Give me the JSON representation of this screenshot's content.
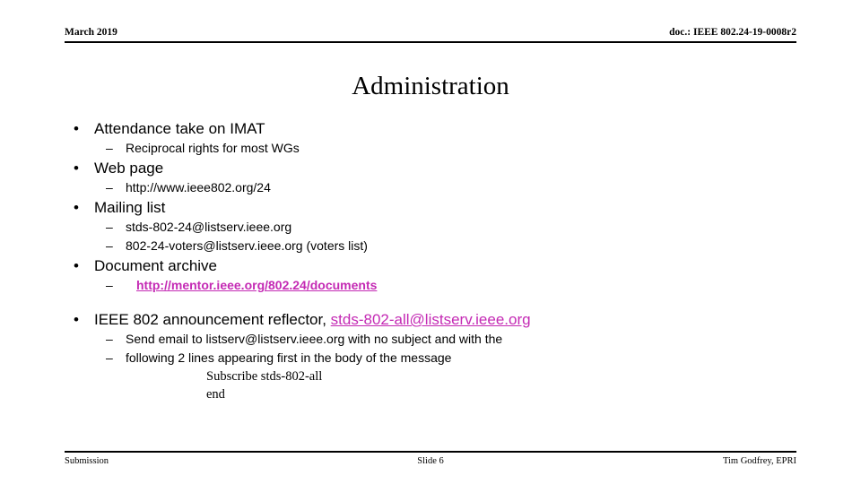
{
  "header": {
    "date": "March 2019",
    "doc_id": "doc.: IEEE 802.24-19-0008r2"
  },
  "title": "Administration",
  "colors": {
    "link": "#c42ab4",
    "text": "#000000",
    "background": "#ffffff"
  },
  "body": {
    "items": [
      {
        "level": 1,
        "text": "Attendance take on IMAT",
        "marker": "•"
      },
      {
        "level": 2,
        "text": "Reciprocal rights for most WGs",
        "marker": "–"
      },
      {
        "level": 1,
        "text": "Web page",
        "marker": "•"
      },
      {
        "level": 2,
        "text": "http://www.ieee802.org/24",
        "marker": "–"
      },
      {
        "level": 1,
        "text": "Mailing list",
        "marker": "•"
      },
      {
        "level": 2,
        "text": "stds-802-24@listserv.ieee.org",
        "marker": "–"
      },
      {
        "level": 2,
        "text": "802-24-voters@listserv.ieee.org (voters list)",
        "marker": "–"
      },
      {
        "level": 1,
        "text": "Document archive",
        "marker": "•"
      },
      {
        "level": 2,
        "text": "http://mentor.ieee.org/802.24/documents",
        "marker": "–",
        "link": true
      },
      {
        "level": 1,
        "text_before_link": "IEEE 802 announcement reflector, ",
        "link_text": "stds-802-all@listserv.ieee.org",
        "marker": "•"
      },
      {
        "level": 2,
        "text": "Send email to listserv@listserv.ieee.org with no subject and with the",
        "marker": "–"
      },
      {
        "level": 2,
        "text": "following 2 lines appearing first in the body of the message",
        "marker": "–"
      }
    ],
    "code_lines": [
      "Subscribe stds-802-all",
      "end"
    ]
  },
  "footer": {
    "left": "Submission",
    "center": "Slide 6",
    "right": "Tim Godfrey, EPRI"
  }
}
